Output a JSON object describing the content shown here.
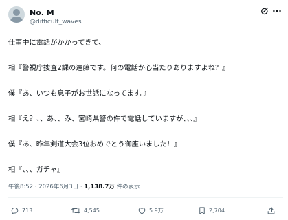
{
  "post": {
    "author_name": "No. M",
    "author_handle": "@difficult_waves",
    "lines": [
      "仕事中に電話がかかってきて、",
      "相『警視庁捜査2課の遠藤です。何の電話か心当たりありますよね？』",
      "僕『あ、いつも息子がお世話になってます。』",
      "相『え？、、あ、、み、宮崎県警の件で電話していますが、、、』",
      "僕『あ、昨年剣道大会3位おめでとう御座いました！』",
      "相『、、、ガチャ』"
    ],
    "time_date": "午後8:52 · 2026年6月3日 · ",
    "views_count": "1,138.7万",
    "views_label": " 件の表示"
  },
  "actions": {
    "replies": "713",
    "reposts": "4,545",
    "likes": "5.9万",
    "bookmarks": "2,704"
  },
  "icons": {
    "avatar": "avatar",
    "grok": "grok-icon",
    "more": "more-icon",
    "reply": "reply-icon",
    "repost": "repost-icon",
    "like": "heart-icon",
    "bookmark": "bookmark-icon",
    "share": "share-icon"
  },
  "colors": {
    "text": "#0f1419",
    "secondary": "#536471",
    "divider": "#eff3f4"
  }
}
